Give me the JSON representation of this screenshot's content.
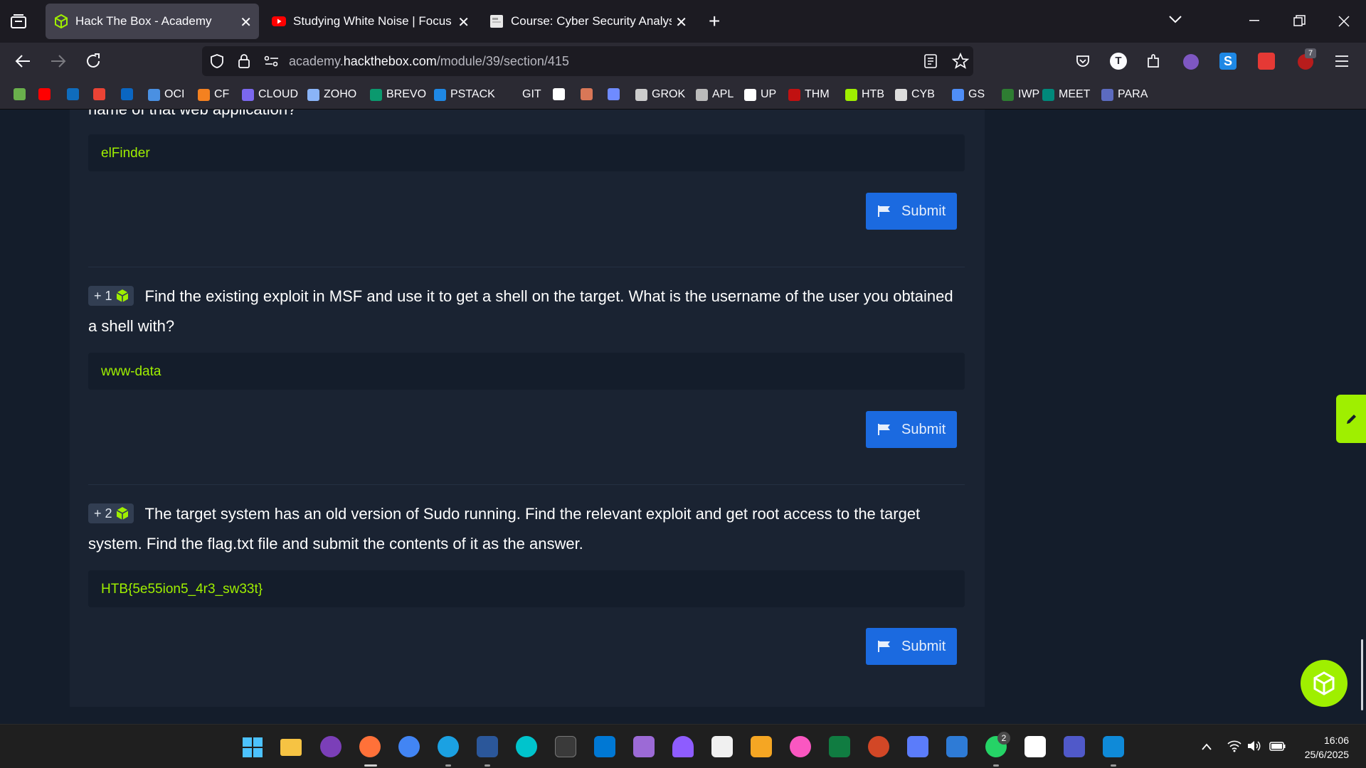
{
  "browser": {
    "tabs": [
      {
        "title": "Hack The Box - Academy",
        "active": true,
        "favicon": "htb-cube-icon"
      },
      {
        "title": "Studying White Noise | Focus on",
        "active": false,
        "favicon": "youtube-icon"
      },
      {
        "title": "Course: Cyber Security Analyst -",
        "active": false,
        "favicon": "page-icon"
      }
    ],
    "url_prefix": "academy.",
    "url_domain": "hackthebox.com",
    "url_path": "/module/39/section/415",
    "extension_badge": "7",
    "profile_letter": "T"
  },
  "bookmarks": [
    {
      "label": "",
      "icon": "chess-icon",
      "color": "#6ab04c"
    },
    {
      "label": "",
      "icon": "youtube-icon",
      "color": "#ff0000"
    },
    {
      "label": "",
      "icon": "outlook-icon",
      "color": "#0f6cbd"
    },
    {
      "label": "",
      "icon": "gmail-icon",
      "color": "#ea4335"
    },
    {
      "label": "",
      "icon": "linkedin-icon",
      "color": "#0a66c2"
    },
    {
      "label": "OCI",
      "icon": "cloud-icon",
      "color": "#4a90e2"
    },
    {
      "label": "CF",
      "icon": "cloudflare-icon",
      "color": "#f48120"
    },
    {
      "label": "CLOUD",
      "icon": "c-icon",
      "color": "#7b68ee"
    },
    {
      "label": "ZOHO",
      "icon": "zoho-icon",
      "color": "#8ab4f8"
    },
    {
      "label": "BREVO",
      "icon": "brevo-icon",
      "color": "#0b996e"
    },
    {
      "label": "PSTACK",
      "icon": "stack-icon",
      "color": "#1e88e5"
    },
    {
      "label": "GIT",
      "icon": "",
      "color": ""
    },
    {
      "label": "",
      "icon": "openai-icon",
      "color": "#ffffff"
    },
    {
      "label": "",
      "icon": "claude-icon",
      "color": "#d97757"
    },
    {
      "label": "",
      "icon": "gemini-icon",
      "color": "#6f8bff"
    },
    {
      "label": "GROK",
      "icon": "grok-icon",
      "color": "#cccccc"
    },
    {
      "label": "APL",
      "icon": "apple-icon",
      "color": "#bbbbbb"
    },
    {
      "label": "UP",
      "icon": "upwork-icon",
      "color": "#ffffff"
    },
    {
      "label": "THM",
      "icon": "thm-icon",
      "color": "#c11111"
    },
    {
      "label": "HTB",
      "icon": "htb-cube-icon",
      "color": "#9fef00"
    },
    {
      "label": "CYB",
      "icon": "cyb-icon",
      "color": "#dddddd"
    },
    {
      "label": "GS",
      "icon": "gs-icon",
      "color": "#4f8ef7"
    },
    {
      "label": "IWP",
      "icon": "iwp-icon",
      "color": "#2e7d32"
    },
    {
      "label": "MEET",
      "icon": "meet-icon",
      "color": "#00897b"
    },
    {
      "label": "PARA",
      "icon": "para-icon",
      "color": "#5c6bc0"
    }
  ],
  "page": {
    "top_cut_text": "name of that web application?",
    "questions": [
      {
        "points": "",
        "text": "",
        "answer": "elFinder",
        "submit_label": "Submit"
      },
      {
        "points": "+ 1",
        "text": "Find the existing exploit in MSF and use it to get a shell on the target. What is the username of the user you obtained a shell with?",
        "answer": "www-data",
        "submit_label": "Submit"
      },
      {
        "points": "+ 2",
        "text": "The target system has an old version of Sudo running. Find the relevant exploit and get root access to the target system. Find the flag.txt file and submit the contents of it as the answer.",
        "answer": "HTB{5e55ion5_4r3_sw33t}",
        "submit_label": "Submit"
      }
    ]
  },
  "taskbar": {
    "whatsapp_badge": "2",
    "time": "16:06",
    "date": "25/6/2025"
  },
  "colors": {
    "accent_green": "#9fef00",
    "submit_blue": "#1b6ae0",
    "page_bg": "#141d2b",
    "card_bg": "#1a2332"
  }
}
